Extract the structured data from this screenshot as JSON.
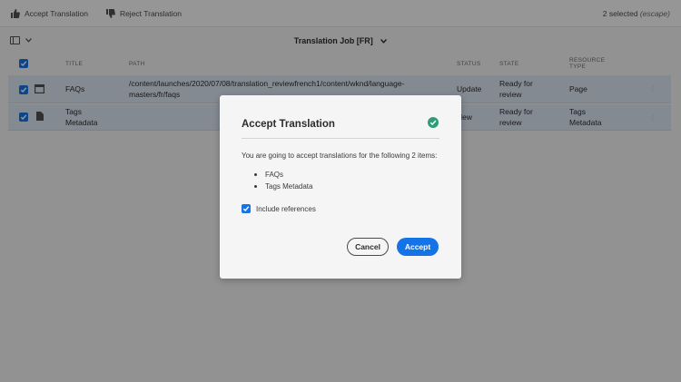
{
  "actionbar": {
    "accept_label": "Accept Translation",
    "reject_label": "Reject Translation",
    "selected_count": "2 selected",
    "escape_hint": "(escape)"
  },
  "titlebar": {
    "title": "Translation Job [FR]"
  },
  "table": {
    "headers": {
      "title": "TITLE",
      "path": "PATH",
      "status": "STATUS",
      "state": "STATE",
      "resource_type_line1": "RESOURCE",
      "resource_type_line2": "TYPE"
    },
    "rows": [
      {
        "title_line1": "FAQs",
        "title_line2": "",
        "path_line1": "/content/launches/2020/07/08/translation_reviewfrench1/content/wknd/language-",
        "path_line2": "masters/fr/faqs",
        "status": "Update",
        "state_line1": "Ready for",
        "state_line2": "review",
        "type_line1": "Page",
        "type_line2": ""
      },
      {
        "title_line1": "Tags",
        "title_line2": "Metadata",
        "path_line1": "",
        "path_line2": "",
        "status": "New",
        "state_line1": "Ready for",
        "state_line2": "review",
        "type_line1": "Tags",
        "type_line2": "Metadata"
      }
    ]
  },
  "dialog": {
    "title": "Accept Translation",
    "message": "You are going to accept translations for the following 2 items:",
    "items": [
      "FAQs",
      "Tags Metadata"
    ],
    "include_references_label": "Include references",
    "include_references_checked": true,
    "cancel_label": "Cancel",
    "accept_label": "Accept"
  },
  "colors": {
    "accent": "#1473e6",
    "success": "#2d9d78",
    "selected_row": "#dde6f4"
  },
  "icons": {
    "accept": "thumbs-up-icon",
    "reject": "thumbs-down-icon",
    "rail": "panel-toggle-icon",
    "page": "page-icon",
    "file": "file-icon",
    "success": "check-circle-icon"
  }
}
